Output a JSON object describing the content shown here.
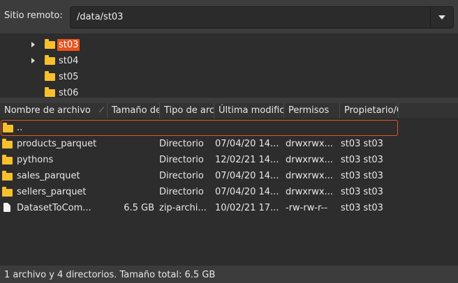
{
  "remote": {
    "label": "Sitio remoto:",
    "path": "/data/st03"
  },
  "tree": [
    {
      "label": "st03",
      "expandable": true,
      "selected": true
    },
    {
      "label": "st04",
      "expandable": true,
      "selected": false
    },
    {
      "label": "st05",
      "expandable": false,
      "selected": false
    },
    {
      "label": "st06",
      "expandable": false,
      "selected": false
    }
  ],
  "columns": {
    "name": "Nombre de archivo",
    "size": "Tamaño de archivo",
    "type": "Tipo de archivo",
    "modified": "Última modificación",
    "perms": "Permisos",
    "owner": "Propietario/Grupo"
  },
  "rows": [
    {
      "name": "..",
      "size": "",
      "type": "",
      "modified": "",
      "perms": "",
      "owner": "",
      "kind": "folder"
    },
    {
      "name": "products_parquet",
      "size": "",
      "type": "Directorio",
      "modified": "07/04/20 14...",
      "perms": "drwxrwx...",
      "owner": "st03 st03",
      "kind": "folder"
    },
    {
      "name": "pythons",
      "size": "",
      "type": "Directorio",
      "modified": "12/02/21 14...",
      "perms": "drwxrwx...",
      "owner": "st03 st03",
      "kind": "folder"
    },
    {
      "name": "sales_parquet",
      "size": "",
      "type": "Directorio",
      "modified": "07/04/20 14...",
      "perms": "drwxrwx...",
      "owner": "st03 st03",
      "kind": "folder"
    },
    {
      "name": "sellers_parquet",
      "size": "",
      "type": "Directorio",
      "modified": "07/04/20 14...",
      "perms": "drwxrwx...",
      "owner": "st03 st03",
      "kind": "folder"
    },
    {
      "name": "DatasetToCom...",
      "size": "6.5 GB",
      "type": "zip-archi...",
      "modified": "10/02/21 17...",
      "perms": "-rw-rw-r--",
      "owner": "st03 st03",
      "kind": "file"
    }
  ],
  "status": "1 archivo y 4 directorios. Tamaño total: 6.5 GB",
  "colors": {
    "accent": "#e95420",
    "folder": "#f7c02c"
  }
}
